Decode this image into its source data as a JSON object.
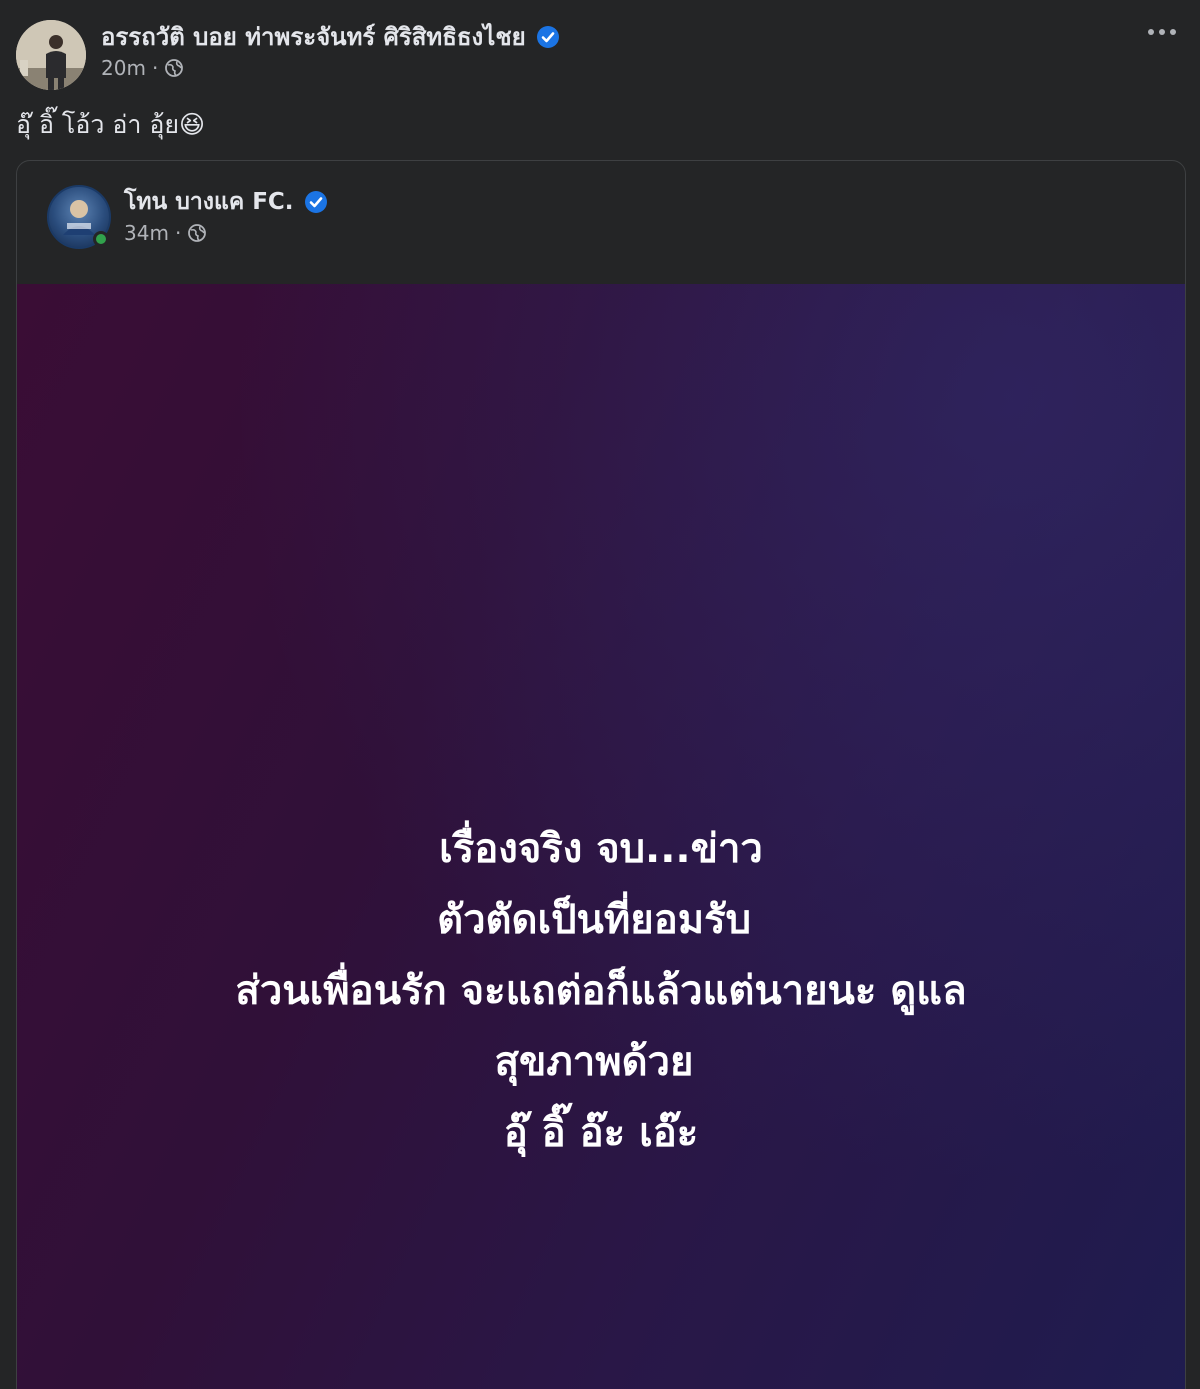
{
  "post": {
    "author_name": "อรรถวัติ บอย ท่าพระจันทร์ ศิริสิทธิธงไชย",
    "timestamp": "20m",
    "meta_separator": "·",
    "caption": "อุ๊ อิ๊ โอ้ว อ่า อุ้ย😆",
    "more_label": "More options"
  },
  "shared_post": {
    "author_name": "โทน บางแค FC.",
    "timestamp": "34m",
    "meta_separator": "·",
    "media_text_lines": [
      "เรื่องจริง จบ...ข่าว",
      "ตัวตัดเป็นที่ยอมรับ ￼",
      "ส่วนเพื่อนรัก จะแถต่อก็แล้วแต่นายนะ ดูแล",
      "สุขภาพด้วย ￼￼",
      "อุ๊ อิ๊ อ๊ะ เอ๊ะ"
    ]
  },
  "icons": {
    "verified": "verified-badge-icon",
    "audience": "globe-icon",
    "more": "ellipsis-icon"
  },
  "colors": {
    "background": "#242526",
    "text_primary": "#e4e6eb",
    "text_secondary": "#b0b3b8",
    "verified_blue": "#1b74e4",
    "online_green": "#31a24c"
  }
}
